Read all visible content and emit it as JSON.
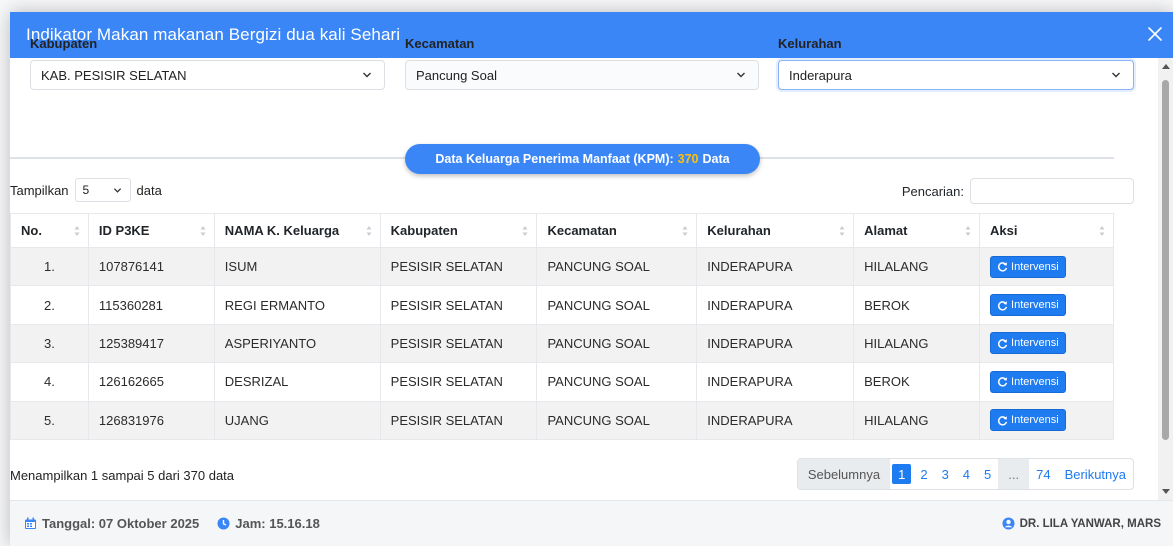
{
  "modal": {
    "title": "Indikator Makan makanan Bergizi dua kali Sehari"
  },
  "filters": {
    "kabupaten": {
      "label": "Kabupaten",
      "value": "KAB. PESISIR SELATAN"
    },
    "kecamatan": {
      "label": "Kecamatan",
      "value": "Pancung Soal"
    },
    "kelurahan": {
      "label": "Kelurahan",
      "value": "Inderapura"
    }
  },
  "kpm": {
    "prefix": "Data Keluarga Penerima Manfaat (KPM):",
    "count": "370",
    "suffix": "Data"
  },
  "table_controls": {
    "show_label": "Tampilkan",
    "page_length": "5",
    "data_label": "data",
    "search_label": "Pencarian:"
  },
  "table": {
    "headers": [
      "No.",
      "ID P3KE",
      "NAMA K. Keluarga",
      "Kabupaten",
      "Kecamatan",
      "Kelurahan",
      "Alamat",
      "Aksi"
    ],
    "rows": [
      [
        "1.",
        "107876141",
        "ISUM",
        "PESISIR SELATAN",
        "PANCUNG SOAL",
        "INDERAPURA",
        "HILALANG"
      ],
      [
        "2.",
        "115360281",
        "REGI ERMANTO",
        "PESISIR SELATAN",
        "PANCUNG SOAL",
        "INDERAPURA",
        "BEROK"
      ],
      [
        "3.",
        "125389417",
        "ASPERIYANTO",
        "PESISIR SELATAN",
        "PANCUNG SOAL",
        "INDERAPURA",
        "HILALANG"
      ],
      [
        "4.",
        "126162665",
        "DESRIZAL",
        "PESISIR SELATAN",
        "PANCUNG SOAL",
        "INDERAPURA",
        "BEROK"
      ],
      [
        "5.",
        "126831976",
        "UJANG",
        "PESISIR SELATAN",
        "PANCUNG SOAL",
        "INDERAPURA",
        "HILALANG"
      ]
    ],
    "action_label": "Intervensi"
  },
  "info": "Menampilkan 1 sampai 5 dari 370 data",
  "pagination": {
    "prev": "Sebelumnya",
    "pages": [
      "1",
      "2",
      "3",
      "4",
      "5"
    ],
    "ellipsis": "...",
    "last": "74",
    "next": "Berikutnya"
  },
  "footer": {
    "date": "Tanggal: 07 Oktober 2025",
    "time": "Jam: 15.16.18",
    "user": "DR. LILA YANWAR, MARS"
  },
  "colors": {
    "primary": "#3a86f7",
    "button": "#1f7bf0",
    "highlight": "#ffc107"
  },
  "icons": {
    "close": "close-icon",
    "chevron": "chevron-down-icon",
    "refresh": "refresh-icon",
    "calendar": "calendar-icon",
    "clock": "clock-icon",
    "user": "user-circle-icon"
  }
}
